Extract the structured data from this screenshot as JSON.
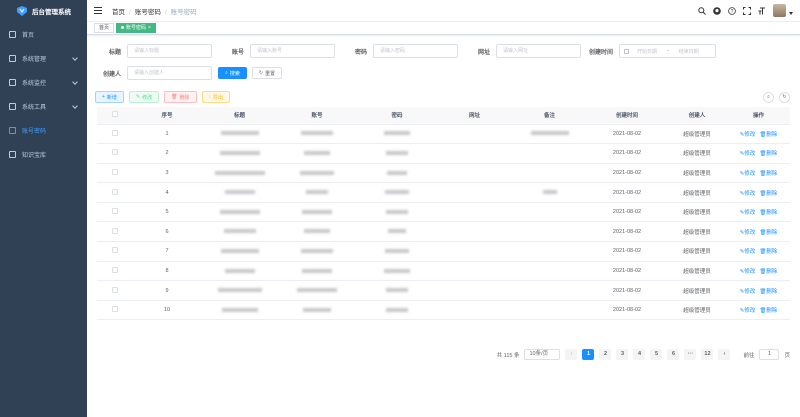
{
  "app": {
    "title": "后台管理系统"
  },
  "sidebar": {
    "items": [
      {
        "label": "首页",
        "icon": "dashboard-icon",
        "arrow": false
      },
      {
        "label": "系统管理",
        "icon": "system-icon",
        "arrow": true
      },
      {
        "label": "系统监控",
        "icon": "monitor-icon",
        "arrow": true
      },
      {
        "label": "系统工具",
        "icon": "tool-icon",
        "arrow": true
      },
      {
        "label": "账号密码",
        "icon": "account-icon",
        "arrow": false,
        "active": true
      },
      {
        "label": "知识宝库",
        "icon": "book-icon",
        "arrow": false
      }
    ]
  },
  "navbar": {
    "breadcrumb": [
      "首页",
      "账号密码",
      "账号密码"
    ],
    "icons": [
      "search-icon",
      "github-icon",
      "question-icon",
      "fullscreen-icon",
      "font-size-icon"
    ]
  },
  "tags": {
    "home": "首页",
    "active": "账号密码",
    "close": "×"
  },
  "search": {
    "title_label": "标题",
    "title_placeholder": "请输入标题",
    "account_label": "账号",
    "account_placeholder": "请输入账号",
    "password_label": "密码",
    "password_placeholder": "请输入密码",
    "url_label": "网址",
    "url_placeholder": "请输入网址",
    "created_label": "创建时间",
    "start_placeholder": "开始日期",
    "range_sep": "-",
    "end_placeholder": "结束日期",
    "creator_label": "创建人",
    "creator_placeholder": "请输入创建人",
    "search_btn": "搜索",
    "reset_btn": "重置"
  },
  "toolbar": {
    "add": "新增",
    "edit": "修改",
    "delete": "删除",
    "export": "导出"
  },
  "colors": {
    "sidebar_bg": "#304156",
    "primary": "#1890ff",
    "active_tag": "#42b983"
  },
  "table": {
    "headers": [
      "",
      "序号",
      "标题",
      "账号",
      "密码",
      "网址",
      "备注",
      "创建时间",
      "创建人",
      "操作"
    ],
    "edit_label": "修改",
    "delete_label": "删除",
    "rows": [
      {
        "no": "1",
        "date": "2021-08-02",
        "creator": "超级管理员"
      },
      {
        "no": "2",
        "date": "2021-08-02",
        "creator": "超级管理员"
      },
      {
        "no": "3",
        "date": "2021-08-02",
        "creator": "超级管理员"
      },
      {
        "no": "4",
        "date": "2021-08-02",
        "creator": "超级管理员"
      },
      {
        "no": "5",
        "date": "2021-08-02",
        "creator": "超级管理员"
      },
      {
        "no": "6",
        "date": "2021-08-02",
        "creator": "超级管理员"
      },
      {
        "no": "7",
        "date": "2021-08-02",
        "creator": "超级管理员"
      },
      {
        "no": "8",
        "date": "2021-08-02",
        "creator": "超级管理员"
      },
      {
        "no": "9",
        "date": "2021-08-02",
        "creator": "超级管理员"
      },
      {
        "no": "10",
        "date": "2021-08-02",
        "creator": "超级管理员"
      }
    ]
  },
  "pagination": {
    "total": "共 115 条",
    "page_size": "10条/页",
    "pages": [
      "1",
      "2",
      "3",
      "4",
      "5",
      "6",
      "···",
      "12"
    ],
    "current": "1",
    "goto_label": "前往",
    "goto_value": "1",
    "page_unit": "页"
  }
}
